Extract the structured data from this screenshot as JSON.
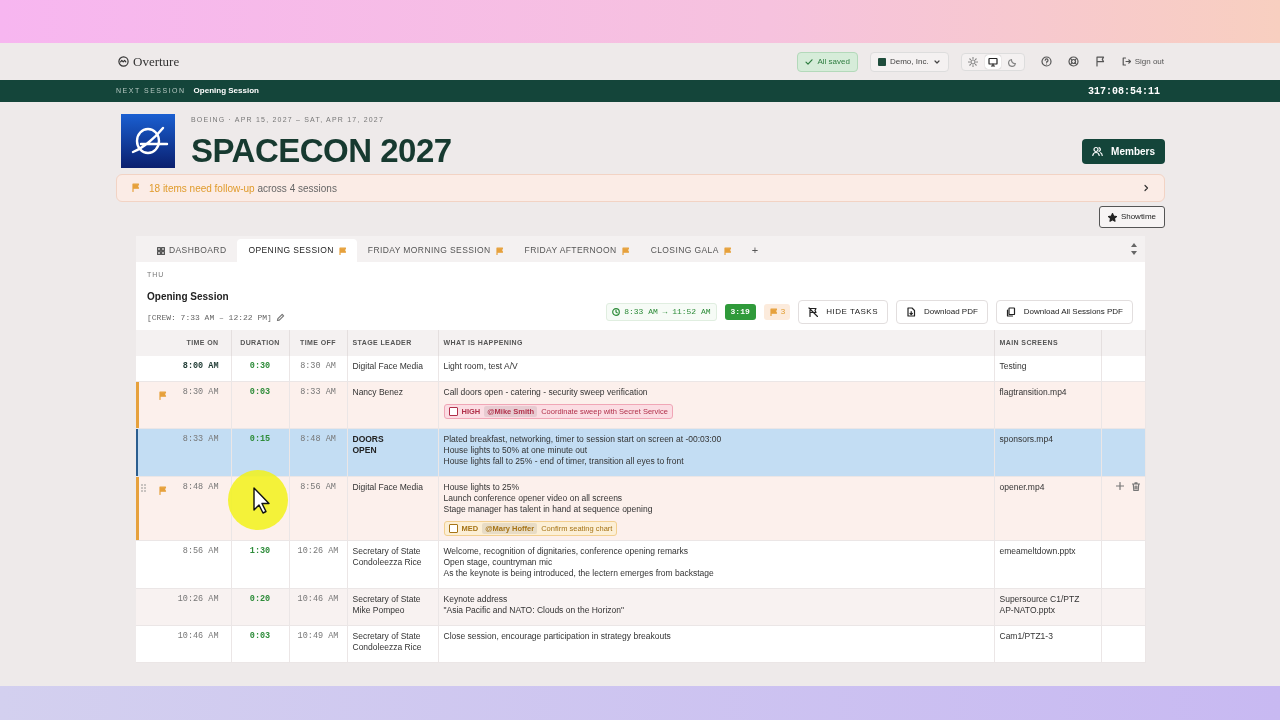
{
  "app": {
    "brand": "Overture",
    "save_status": "All saved",
    "org": "Demo, Inc.",
    "theme_modes": [
      {
        "kind": "light",
        "selected": false
      },
      {
        "kind": "system",
        "selected": true
      },
      {
        "kind": "dark",
        "selected": false
      }
    ],
    "sign_out": "Sign out"
  },
  "next_session": {
    "label": "NEXT SESSION",
    "name": "Opening Session",
    "countdown": "317:08:54:11"
  },
  "event": {
    "meta": "BOEING · APR 15, 2027 – SAT, APR 17, 2027",
    "title": "SPACECON 2027",
    "members_button": "Members"
  },
  "alert": {
    "highlight": "18 items need follow-up",
    "rest": "across 4 sessions"
  },
  "showtime_button": "Showtime",
  "tabs": [
    {
      "label": "DASHBOARD",
      "kind": "dashboard",
      "flagged": false,
      "selected": false
    },
    {
      "label": "OPENING SESSION",
      "kind": "session",
      "flagged": true,
      "selected": true
    },
    {
      "label": "FRIDAY MORNING SESSION",
      "kind": "session",
      "flagged": true,
      "selected": false
    },
    {
      "label": "FRIDAY AFTERNOON",
      "kind": "session",
      "flagged": true,
      "selected": false
    },
    {
      "label": "CLOSING GALA",
      "kind": "session",
      "flagged": true,
      "selected": false
    }
  ],
  "add_tab": "+",
  "session": {
    "day": "THU",
    "name": "Opening Session",
    "crew": "[CREW: 7:33 AM – 12:22 PM]",
    "window": "8:33 AM → 11:52 AM",
    "duration": "3:19",
    "flag_count": "3",
    "hide_tasks": "HIDE TASKS",
    "download": "Download PDF",
    "download_all": "Download All Sessions PDF"
  },
  "table": {
    "columns": [
      "TIME ON",
      "DURATION",
      "TIME OFF",
      "STAGE LEADER",
      "WHAT IS HAPPENING",
      "MAIN SCREENS"
    ],
    "rows": [
      {
        "time_on": "8:00 AM",
        "duration": "0:30",
        "time_off": "8:30 AM",
        "leader": [
          "Digital Face Media"
        ],
        "leader_bold": false,
        "happening": [
          "Light room, test A/V"
        ],
        "screens": [
          "Testing"
        ],
        "flagged": false,
        "selected": false,
        "current": true,
        "hovered": false,
        "shaded": false
      },
      {
        "time_on": "8:30 AM",
        "duration": "0:03",
        "time_off": "8:33 AM",
        "leader": [
          "Nancy Benez"
        ],
        "leader_bold": false,
        "happening": [
          "Call doors open - catering - security sweep verification"
        ],
        "screens": [
          "flagtransition.mp4"
        ],
        "flagged": true,
        "selected": false,
        "current": false,
        "hovered": false,
        "shaded": false,
        "task": {
          "kind": "high",
          "priority": "HIGH",
          "assignee": "@Mike Smith",
          "text": "Coordinate sweep with Secret Service",
          "checked": false
        }
      },
      {
        "time_on": "8:33 AM",
        "duration": "0:15",
        "time_off": "8:48 AM",
        "leader": [
          "DOORS",
          "OPEN"
        ],
        "leader_bold": true,
        "happening": [
          "Plated breakfast, networking, timer to session start on screen at -00:03:00",
          "House lights to 50% at one minute out",
          "House lights fall to 25% - end of timer, transition all eyes to front"
        ],
        "screens": [
          "sponsors.mp4"
        ],
        "flagged": false,
        "selected": true,
        "current": false,
        "hovered": false,
        "shaded": false
      },
      {
        "time_on": "8:48 AM",
        "time_off": "8:56 AM",
        "leader": [
          "Digital Face Media"
        ],
        "leader_bold": false,
        "happening": [
          "House lights to 25%",
          "Launch conference opener video on all screens",
          "Stage manager has talent in hand at sequence opening"
        ],
        "screens": [
          "opener.mp4"
        ],
        "flagged": true,
        "selected": false,
        "current": false,
        "hovered": true,
        "shaded": false,
        "task": {
          "kind": "med",
          "priority": "MED",
          "assignee": "@Mary Hoffer",
          "text": "Confirm seating chart",
          "checked": false
        }
      },
      {
        "time_on": "8:56 AM",
        "duration": "1:30",
        "time_off": "10:26 AM",
        "leader": [
          "Secretary of State",
          "Condoleezza Rice"
        ],
        "leader_bold": false,
        "happening": [
          "Welcome, recognition of dignitaries, conference opening remarks",
          "Open stage, countryman mic",
          "As the keynote is being introduced, the lectern emerges from backstage"
        ],
        "screens": [
          "emeameltdown.pptx"
        ],
        "flagged": false,
        "selected": false,
        "current": false,
        "hovered": false,
        "shaded": false
      },
      {
        "time_on": "10:26 AM",
        "duration": "0:20",
        "time_off": "10:46 AM",
        "leader": [
          "Secretary of State",
          "Mike Pompeo"
        ],
        "leader_bold": false,
        "happening": [
          "Keynote address",
          "\"Asia Pacific and NATO: Clouds on the Horizon\""
        ],
        "screens": [
          "Supersource C1/PTZ",
          "AP-NATO.pptx"
        ],
        "flagged": false,
        "selected": false,
        "current": false,
        "hovered": false,
        "shaded": true
      },
      {
        "time_on": "10:46 AM",
        "duration": "0:03",
        "time_off": "10:49 AM",
        "leader": [
          "Secretary of State",
          "Condoleezza Rice"
        ],
        "leader_bold": false,
        "happening": [
          "Close session, encourage participation in strategy breakouts"
        ],
        "screens": [
          "Cam1/PTZ1-3"
        ],
        "flagged": false,
        "selected": false,
        "current": false,
        "hovered": false,
        "shaded": false
      }
    ]
  }
}
